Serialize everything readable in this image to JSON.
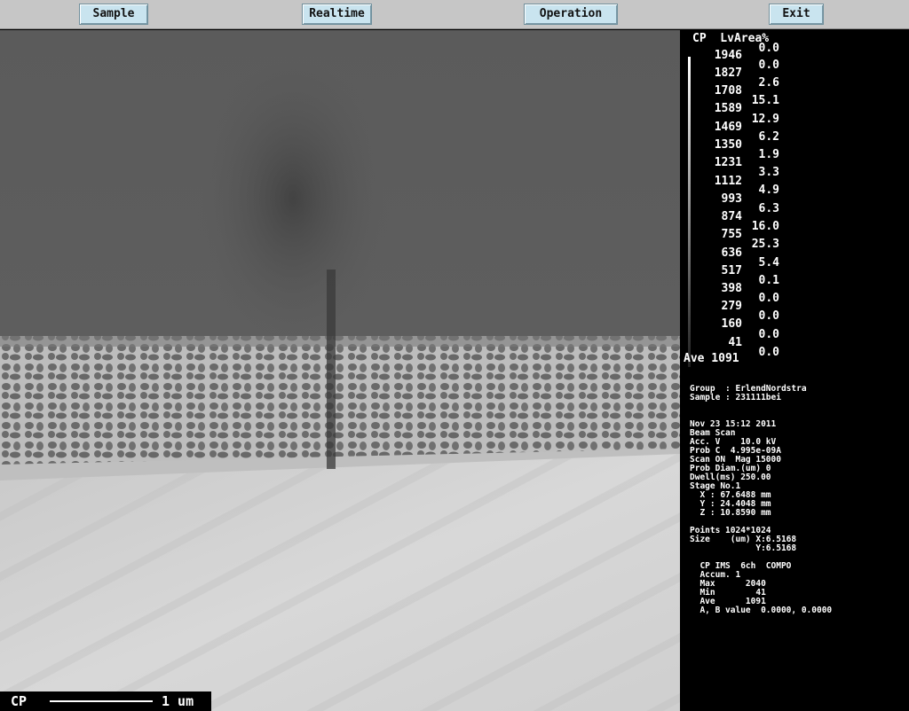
{
  "menu": {
    "sample": "Sample",
    "realtime": "Realtime",
    "operation": "Operation",
    "exit": "Exit"
  },
  "colors": {
    "menu_bg": "#c6c6c6",
    "button_bg": "#c9e4ef",
    "panel_bg": "#000000"
  },
  "image": {
    "scalebar_left": "CP",
    "scalebar_right": "1 um"
  },
  "histogram": {
    "header": "CP  LvArea%",
    "levels": [
      "1946",
      "1827",
      "1708",
      "1589",
      "1469",
      "1350",
      "1231",
      "1112",
      "993",
      "874",
      "755",
      "636",
      "517",
      "398",
      "279",
      "160",
      "41"
    ],
    "areas": [
      "0.0",
      "0.0",
      "2.6",
      "15.1",
      "12.9",
      "6.2",
      "1.9",
      "3.3",
      "4.9",
      "6.3",
      "16.0",
      "25.3",
      "5.4",
      "0.1",
      "0.0",
      "0.0",
      "0.0",
      "0.0"
    ],
    "average": "Ave 1091"
  },
  "info": {
    "group": "Group  : ErlendNordstra",
    "sample": "Sample : 231111bei",
    "datetime": "Nov 23 15:12 2011",
    "beam_scan": "Beam Scan",
    "acc_v": "Acc. V    10.0 kV",
    "prob_c": "Prob C  4.995e-09A",
    "scan": "Scan ON  Mag 15000",
    "prob_diam": "Prob Diam.(um) 0",
    "dwell": "Dwell(ms) 250.00",
    "stage": "Stage No.1",
    "stage_x": "  X : 67.6488 mm",
    "stage_y": "  Y : 24.4048 mm",
    "stage_z": "  Z : 10.8590 mm",
    "points": "Points 1024*1024",
    "size_x": "Size    (um) X:6.5168",
    "size_y": "             Y:6.5168",
    "cp_line": "  CP IMS  6ch  COMPO",
    "accum": "  Accum. 1",
    "max": "  Max      2040",
    "min": "  Min        41",
    "ave": "  Ave      1091",
    "ab_value": "  A, B value  0.0000, 0.0000"
  }
}
